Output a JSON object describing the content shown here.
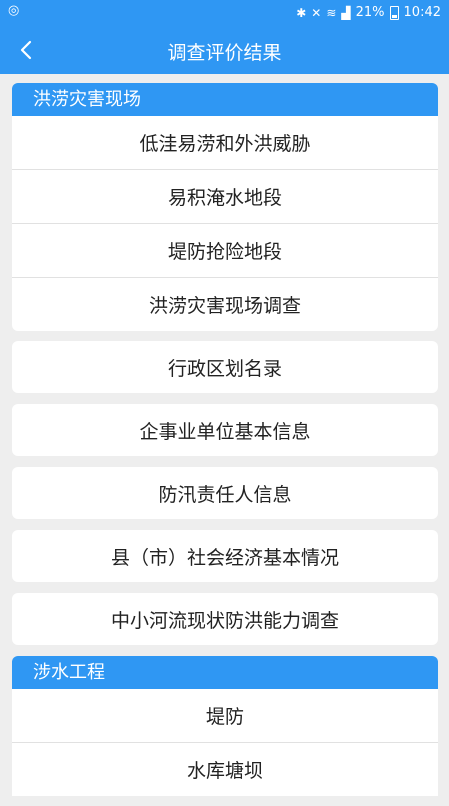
{
  "status": {
    "battery": "21%",
    "time": "10:42"
  },
  "header": {
    "title": "调查评价结果"
  },
  "sections": [
    {
      "title": "洪涝灾害现场",
      "items": [
        "低洼易涝和外洪威胁",
        "易积淹水地段",
        "堤防抢险地段",
        "洪涝灾害现场调查"
      ]
    }
  ],
  "cards": [
    "行政区划名录",
    "企事业单位基本信息",
    "防汛责任人信息",
    "县（市）社会经济基本情况",
    "中小河流现状防洪能力调查"
  ],
  "section2": {
    "title": "涉水工程",
    "items": [
      "堤防",
      "水库塘坝"
    ]
  },
  "colors": {
    "primary": "#2f97f3",
    "background": "#eeeeee"
  }
}
